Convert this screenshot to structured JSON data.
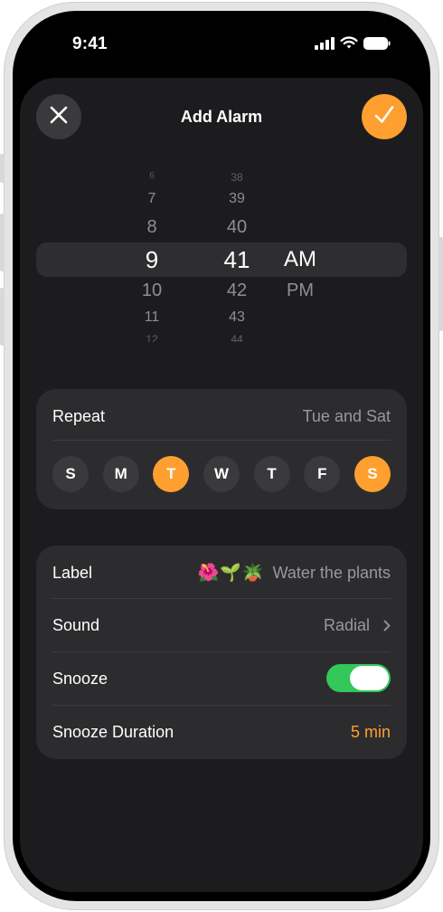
{
  "status_bar": {
    "time": "9:41"
  },
  "header": {
    "title": "Add Alarm"
  },
  "time_picker": {
    "hours": [
      "6",
      "7",
      "8",
      "9",
      "10",
      "11",
      "12"
    ],
    "minutes": [
      "38",
      "39",
      "40",
      "41",
      "42",
      "43",
      "44"
    ],
    "periods": [
      "AM",
      "PM"
    ],
    "selected_hour": "9",
    "selected_minute": "41",
    "selected_period": "AM"
  },
  "repeat": {
    "label": "Repeat",
    "value": "Tue and Sat",
    "days": [
      {
        "letter": "S",
        "selected": false
      },
      {
        "letter": "M",
        "selected": false
      },
      {
        "letter": "T",
        "selected": true
      },
      {
        "letter": "W",
        "selected": false
      },
      {
        "letter": "T",
        "selected": false
      },
      {
        "letter": "F",
        "selected": false
      },
      {
        "letter": "S",
        "selected": true
      }
    ]
  },
  "settings": {
    "label_row": {
      "label": "Label",
      "emoji": "🌺🌱🪴",
      "value": "Water the plants"
    },
    "sound_row": {
      "label": "Sound",
      "value": "Radial"
    },
    "snooze_row": {
      "label": "Snooze",
      "enabled": true
    },
    "duration_row": {
      "label": "Snooze Duration",
      "value": "5 min"
    }
  },
  "colors": {
    "accent": "#ff9f2f",
    "toggle_on": "#34c759",
    "sheet": "#1c1c1e",
    "card": "#2c2c2e"
  }
}
